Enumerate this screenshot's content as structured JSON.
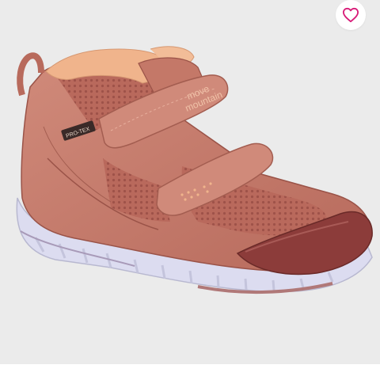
{
  "product": {
    "brand_text": [
      "move",
      "mountain"
    ],
    "tongue_label": "PRO-TEX",
    "colors": {
      "upper": "#c67c6c",
      "mesh": "#b9695c",
      "lining": "#f0b48c",
      "sole": "#dcdcf0",
      "toe_cap": "#8c3c3a",
      "background": "#ebebeb"
    }
  },
  "wishlist": {
    "icon": "heart-outline-icon",
    "color": "#d81b78"
  }
}
